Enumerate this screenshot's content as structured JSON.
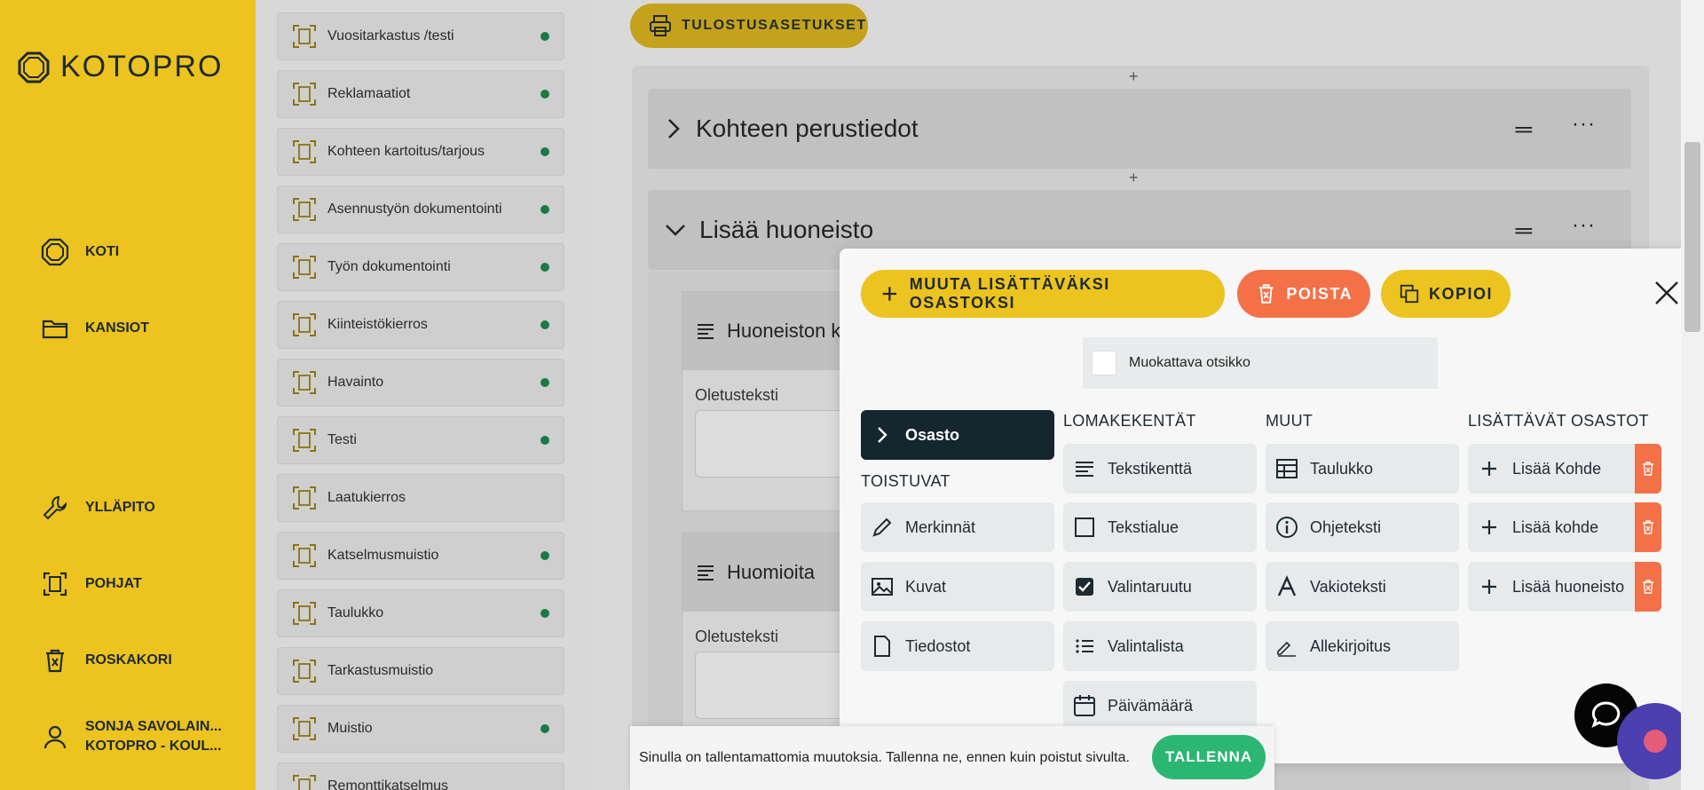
{
  "app": {
    "logo_text": "KOTOPRO"
  },
  "sidebar": {
    "nav": [
      {
        "label": "KOTI",
        "icon": "octagon-home-icon"
      },
      {
        "label": "KANSIOT",
        "icon": "folder-icon"
      },
      {
        "label": "YLLÄPITO",
        "icon": "wrench-icon"
      },
      {
        "label": "POHJAT",
        "icon": "template-icon"
      },
      {
        "label": "ROSKAKORI",
        "icon": "trash-icon"
      }
    ],
    "user": {
      "name": "SONJA SAVOLAIN...",
      "org": "KOTOPRO - KOUL..."
    }
  },
  "form_list": [
    {
      "label": "Vuositarkastus /testi",
      "active": true
    },
    {
      "label": "Reklamaatiot",
      "active": true
    },
    {
      "label": "Kohteen kartoitus/tarjous",
      "active": true
    },
    {
      "label": "Asennustyön dokumentointi",
      "active": true
    },
    {
      "label": "Työn dokumentointi",
      "active": true
    },
    {
      "label": "Kiinteistökierros",
      "active": true
    },
    {
      "label": "Havainto",
      "active": true
    },
    {
      "label": "Testi",
      "active": true
    },
    {
      "label": "Laatukierros",
      "active": false
    },
    {
      "label": "Katselmusmuistio",
      "active": true
    },
    {
      "label": "Taulukko",
      "active": true
    },
    {
      "label": "Tarkastusmuistio",
      "active": false
    },
    {
      "label": "Muistio",
      "active": true
    },
    {
      "label": "Remonttikatselmus",
      "active": false
    }
  ],
  "editor": {
    "print_button": "TULOSTUSASETUKSET",
    "add_symbol": "+",
    "sections": [
      {
        "title": "Kohteen perustiedot",
        "expanded": false
      },
      {
        "title": "Lisää huoneisto",
        "expanded": true
      }
    ],
    "fields": [
      {
        "title": "Huoneiston k",
        "default_label": "Oletusteksti"
      },
      {
        "title": "Huomioita",
        "default_label": "Oletusteksti"
      }
    ]
  },
  "modal": {
    "buttons": {
      "change": "MUUTA LISÄTTÄVÄKSI OSASTOKSI",
      "delete": "POISTA",
      "copy": "KOPIOI"
    },
    "custom_title_label": "Muokattava otsikko",
    "section_tile": "Osasto",
    "headings": {
      "repeating": "TOISTUVAT",
      "form_fields": "LOMAKEKENTÄT",
      "other": "MUUT",
      "addable": "LISÄTTÄVÄT OSASTOT"
    },
    "repeating": [
      {
        "label": "Merkinnät",
        "icon": "pencil-icon"
      },
      {
        "label": "Kuvat",
        "icon": "image-icon"
      },
      {
        "label": "Tiedostot",
        "icon": "file-icon"
      }
    ],
    "form_fields": [
      {
        "label": "Tekstikenttä",
        "icon": "text-lines-icon"
      },
      {
        "label": "Tekstialue",
        "icon": "square-icon"
      },
      {
        "label": "Valintaruutu",
        "icon": "checkbox-icon"
      },
      {
        "label": "Valintalista",
        "icon": "list-icon"
      },
      {
        "label": "Päivämäärä",
        "icon": "calendar-icon"
      }
    ],
    "other": [
      {
        "label": "Taulukko",
        "icon": "table-icon"
      },
      {
        "label": "Ohjeteksti",
        "icon": "info-icon"
      },
      {
        "label": "Vakioteksti",
        "icon": "serif-a-icon"
      },
      {
        "label": "Allekirjoitus",
        "icon": "signature-icon"
      }
    ],
    "addable": [
      {
        "label": "Lisää Kohde"
      },
      {
        "label": "Lisää kohde"
      },
      {
        "label": "Lisää huoneisto"
      }
    ]
  },
  "banner": {
    "text": "Sinulla on tallentamattomia muutoksia. Tallenna ne, ennen kuin poistut sivulta.",
    "save": "TALLENNA"
  },
  "colors": {
    "brand_yellow": "#ecc31f",
    "danger": "#f47047",
    "success": "#2bb672",
    "dark": "#14262e"
  }
}
